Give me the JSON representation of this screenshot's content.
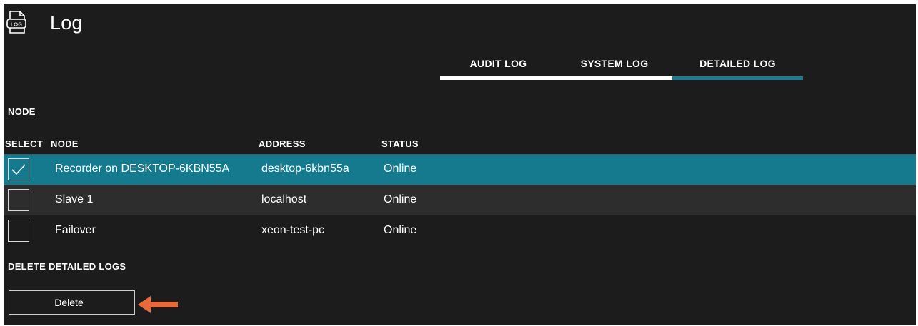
{
  "header": {
    "title": "Log",
    "icon": "log-file-icon",
    "icon_text": "LOG"
  },
  "tabs": [
    {
      "label": "AUDIT LOG",
      "active": false
    },
    {
      "label": "SYSTEM LOG",
      "active": false
    },
    {
      "label": "DETAILED LOG",
      "active": true
    }
  ],
  "node_section": {
    "title": "NODE",
    "columns": {
      "select": "SELECT",
      "node": "NODE",
      "address": "ADDRESS",
      "status": "STATUS"
    },
    "rows": [
      {
        "selected": true,
        "node": "Recorder on DESKTOP-6KBN55A",
        "address": "desktop-6kbn55a",
        "status": "Online"
      },
      {
        "selected": false,
        "node": "Slave 1",
        "address": "localhost",
        "status": "Online"
      },
      {
        "selected": false,
        "node": "Failover",
        "address": "xeon-test-pc",
        "status": "Online"
      }
    ]
  },
  "delete_section": {
    "title": "DELETE DETAILED LOGS",
    "button_label": "Delete"
  },
  "colors": {
    "accent": "#1e7c90",
    "selected_row": "#167a8f",
    "background": "#1c1c1c",
    "arrow": "#e86a3a"
  }
}
